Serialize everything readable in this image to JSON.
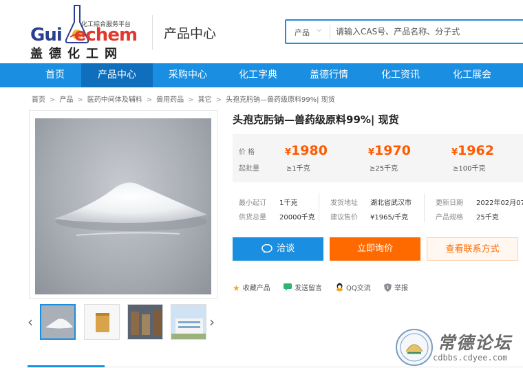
{
  "logo": {
    "tagline": "化工综合服务平台",
    "word_a": "Gui",
    "word_b": "echem",
    "cn": "盖德化工网"
  },
  "header": {
    "section_title": "产品中心",
    "search": {
      "category": "产品",
      "placeholder": "请输入CAS号、产品名称、分子式"
    }
  },
  "nav": {
    "items": [
      {
        "label": "首页"
      },
      {
        "label": "产品中心",
        "active": true
      },
      {
        "label": "采购中心"
      },
      {
        "label": "化工字典"
      },
      {
        "label": "盖德行情"
      },
      {
        "label": "化工资讯"
      },
      {
        "label": "化工展会"
      }
    ]
  },
  "breadcrumb": [
    "首页",
    "产品",
    "医药中间体及辅料",
    "兽用药品",
    "其它",
    "头孢克肟钠—兽药级原料99%| 现货"
  ],
  "product": {
    "title": "头孢克肟钠—兽药级原料99%| 现货",
    "price_label": "价 格",
    "moq_label": "起批量",
    "currency": "¥",
    "tiers": [
      {
        "price": "1980",
        "moq": "≥1千克"
      },
      {
        "price": "1970",
        "moq": "≥25千克"
      },
      {
        "price": "1962",
        "moq": "≥100千克"
      }
    ],
    "specs": {
      "min_order_label": "最小起订",
      "min_order": "1千克",
      "supply_label": "供货总量",
      "supply": "20000千克",
      "ship_label": "发货地址",
      "ship": "湖北省武汉市",
      "suggest_label": "建议售价",
      "suggest": "¥1965/千克",
      "updated_label": "更新日期",
      "updated": "2022年02月07",
      "spec_label": "产品规格",
      "spec": "25千克"
    },
    "buttons": {
      "chat": "洽谈",
      "inquiry": "立即询价",
      "contact": "查看联系方式"
    },
    "actions": [
      {
        "label": "收藏产品",
        "icon": "star-icon"
      },
      {
        "label": "发送留言",
        "icon": "message-icon"
      },
      {
        "label": "QQ交流",
        "icon": "qq-icon"
      },
      {
        "label": "举报",
        "icon": "shield-icon"
      }
    ]
  },
  "watermark": {
    "cn": "常德论坛",
    "url": "cdbbs.cdyee.com"
  },
  "colors": {
    "brand_blue": "#1a8ee1",
    "price_orange": "#ff5a00",
    "inquiry_orange": "#ff6a00"
  }
}
